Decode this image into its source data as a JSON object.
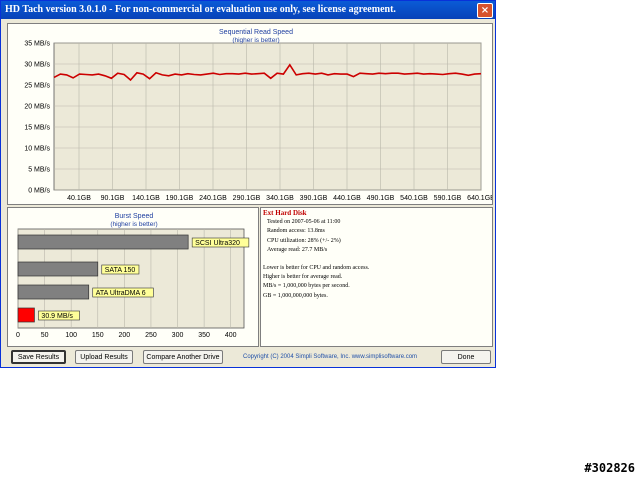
{
  "window": {
    "title": "HD Tach version 3.0.1.0  - For non-commercial or evaluation use only, see license agreement.",
    "close_glyph": "×"
  },
  "read_chart": {
    "title": "Sequential Read Speed",
    "subtitle": "(higher is better)",
    "y_ticks": [
      "0 MB/s",
      "5 MB/s",
      "10 MB/s",
      "15 MB/s",
      "20 MB/s",
      "25 MB/s",
      "30 MB/s",
      "35 MB/s"
    ],
    "x_ticks": [
      "40.1GB",
      "90.1GB",
      "140.1GB",
      "190.1GB",
      "240.1GB",
      "290.1GB",
      "340.1GB",
      "390.1GB",
      "440.1GB",
      "490.1GB",
      "540.1GB",
      "590.1GB",
      "640.1GB"
    ]
  },
  "burst_chart": {
    "title": "Burst Speed",
    "subtitle": "(higher is better)",
    "x_ticks": [
      "0",
      "50",
      "100",
      "150",
      "200",
      "250",
      "300",
      "350",
      "400"
    ]
  },
  "chart_data": [
    {
      "type": "line",
      "title": "Sequential Read Speed",
      "subtitle": "(higher is better)",
      "ylabel": "MB/s",
      "ylim": [
        0,
        35
      ],
      "x": [
        0,
        10,
        20,
        30,
        40,
        50,
        60,
        70,
        80,
        90,
        100,
        110,
        120,
        130,
        140,
        150,
        160,
        170,
        180,
        190,
        200,
        210,
        220,
        230,
        240,
        250,
        260,
        270,
        280,
        290,
        300,
        310,
        320,
        330,
        340,
        350,
        360,
        370,
        380,
        390,
        400,
        410,
        420,
        430,
        440,
        450,
        460,
        470,
        480,
        490,
        500,
        510,
        520,
        530,
        540,
        550,
        560,
        570,
        580,
        590,
        600,
        610,
        620,
        630,
        640,
        650,
        660,
        670
      ],
      "x_ticks": [
        "40.1GB",
        "90.1GB",
        "140.1GB",
        "190.1GB",
        "240.1GB",
        "290.1GB",
        "340.1GB",
        "390.1GB",
        "440.1GB",
        "490.1GB",
        "540.1GB",
        "590.1GB",
        "640.1GB"
      ],
      "series": [
        {
          "color": "#cc0000",
          "values": [
            26.8,
            27.6,
            27.4,
            26.7,
            27.6,
            27.5,
            27.4,
            27.6,
            27.2,
            26.6,
            27.8,
            27.5,
            26.2,
            27.9,
            27.6,
            26.5,
            27.9,
            27.4,
            27.2,
            27.6,
            27.4,
            27.7,
            27.5,
            27.4,
            27.6,
            27.8,
            27.5,
            27.7,
            27.7,
            27.6,
            27.8,
            27.6,
            27.7,
            27.8,
            26.6,
            27.8,
            27.6,
            29.8,
            27.4,
            27.7,
            27.8,
            27.6,
            27.8,
            27.4,
            27.7,
            27.6,
            27.6,
            27.0,
            27.8,
            27.7,
            27.6,
            27.8,
            27.7,
            27.8,
            27.8,
            27.6,
            27.7,
            27.8,
            27.6,
            27.7,
            27.6,
            27.5,
            27.7,
            27.8,
            27.6,
            27.3,
            27.6,
            27.7
          ]
        }
      ]
    },
    {
      "type": "bar",
      "title": "Burst Speed",
      "subtitle": "(higher is better)",
      "xlim": [
        0,
        425
      ],
      "categories": [
        "SCSI Ultra320",
        "SATA 150",
        "ATA UltraDMA 6",
        "30.9 MB/s"
      ],
      "values": [
        320,
        150,
        133,
        30.9
      ],
      "colors": [
        "#808080",
        "#808080",
        "#808080",
        "#ff0000"
      ]
    }
  ],
  "info": {
    "title": "Ext Hard Disk",
    "lines": [
      "Tested on 2007-05-06 at 11:00",
      "Random access: 13.8ms",
      "CPU utilization: 28% (+/- 2%)",
      "Average read: 27.7 MB/s"
    ],
    "notes": [
      "Lower is better for CPU and random access.",
      "Higher is better for average read.",
      "MB/s = 1,000,000 bytes per second.",
      "GB = 1,000,000,000 bytes."
    ]
  },
  "buttons": {
    "save": "Save Results",
    "upload": "Upload Results",
    "compare": "Compare Another Drive",
    "done": "Done"
  },
  "copyright": "Copyright (C) 2004 Simpli Software, Inc. www.simplisoftware.com",
  "watermark": "#302826"
}
